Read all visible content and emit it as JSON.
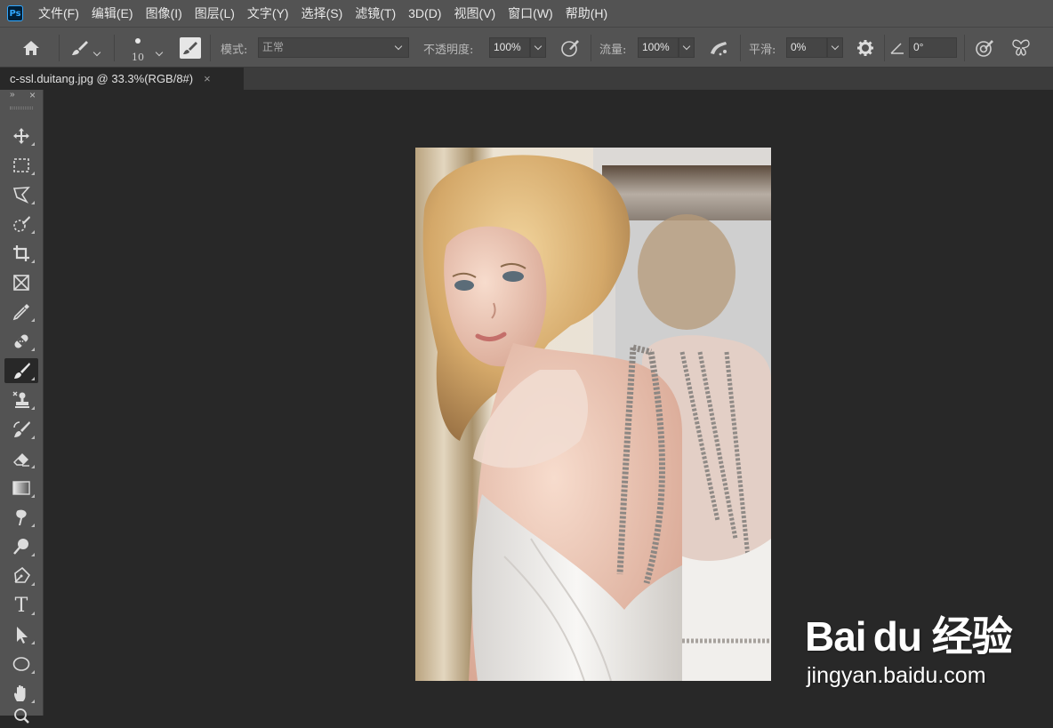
{
  "app": {
    "logo_text": "Ps"
  },
  "menu": [
    "文件(F)",
    "编辑(E)",
    "图像(I)",
    "图层(L)",
    "文字(Y)",
    "选择(S)",
    "滤镜(T)",
    "3D(D)",
    "视图(V)",
    "窗口(W)",
    "帮助(H)"
  ],
  "options": {
    "brush_size": "10",
    "mode_label": "模式:",
    "mode_value": "正常",
    "opacity_label": "不透明度:",
    "opacity_value": "100%",
    "flow_label": "流量:",
    "flow_value": "100%",
    "smoothing_label": "平滑:",
    "smoothing_value": "0%",
    "angle_value": "0°"
  },
  "document_tab": {
    "title": "c-ssl.duitang.jpg @ 33.3%(RGB/8#)",
    "close": "×"
  },
  "toolbar": {
    "collapse": "»",
    "close": "×",
    "tools": [
      {
        "name": "move-tool",
        "icon": "move-icon"
      },
      {
        "name": "marquee-tool",
        "icon": "rect-marquee-icon"
      },
      {
        "name": "lasso-tool",
        "icon": "polygon-lasso-icon"
      },
      {
        "name": "quick-selection-tool",
        "icon": "quick-selection-icon"
      },
      {
        "name": "crop-tool",
        "icon": "crop-icon"
      },
      {
        "name": "frame-tool",
        "icon": "frame-icon"
      },
      {
        "name": "eyedropper-tool",
        "icon": "eyedropper-icon"
      },
      {
        "name": "healing-brush-tool",
        "icon": "bandage-icon"
      },
      {
        "name": "brush-tool",
        "icon": "brush-icon",
        "active": true
      },
      {
        "name": "clone-stamp-tool",
        "icon": "stamp-icon"
      },
      {
        "name": "history-brush-tool",
        "icon": "history-brush-icon"
      },
      {
        "name": "eraser-tool",
        "icon": "eraser-icon"
      },
      {
        "name": "gradient-tool",
        "icon": "gradient-icon"
      },
      {
        "name": "smudge-tool",
        "icon": "smudge-icon"
      },
      {
        "name": "dodge-tool",
        "icon": "dodge-icon"
      },
      {
        "name": "pen-tool",
        "icon": "pen-icon"
      },
      {
        "name": "type-tool",
        "icon": "type-icon",
        "glyph": "T"
      },
      {
        "name": "path-selection-tool",
        "icon": "arrow-icon"
      },
      {
        "name": "ellipse-tool",
        "icon": "ellipse-icon"
      },
      {
        "name": "hand-tool",
        "icon": "hand-icon"
      },
      {
        "name": "zoom-tool",
        "icon": "zoom-icon"
      }
    ]
  },
  "watermark": {
    "logo": "Bai du 经验",
    "url": "jingyan.baidu.com"
  }
}
